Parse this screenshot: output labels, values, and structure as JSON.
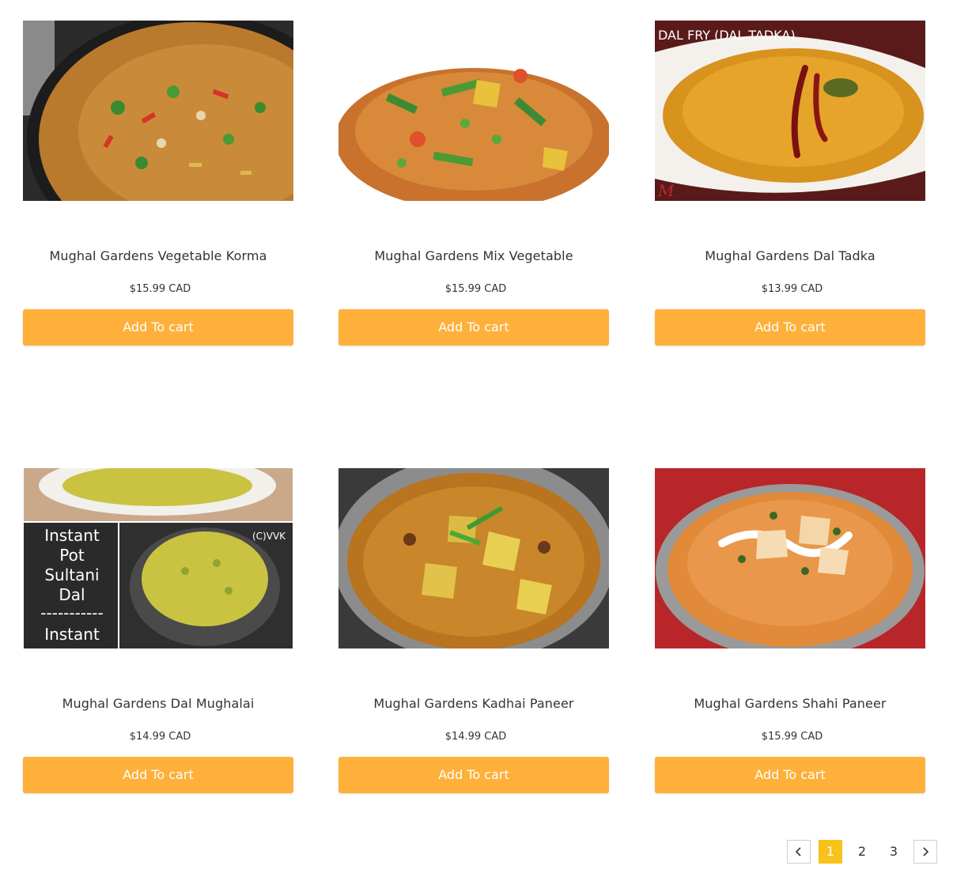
{
  "currency_note": "CAD",
  "products": [
    {
      "title": "Mughal Gardens Vegetable Korma",
      "price": "$15.99 CAD",
      "button": "Add To cart"
    },
    {
      "title": "Mughal Gardens Mix Vegetable",
      "price": "$15.99 CAD",
      "button": "Add To cart"
    },
    {
      "title": "Mughal Gardens Dal Tadka",
      "price": "$13.99 CAD",
      "button": "Add To cart"
    },
    {
      "title": "Mughal Gardens Dal Mughalai",
      "price": "$14.99 CAD",
      "button": "Add To cart"
    },
    {
      "title": "Mughal Gardens Kadhai Paneer",
      "price": "$14.99 CAD",
      "button": "Add To cart"
    },
    {
      "title": "Mughal Gardens Shahi Paneer",
      "price": "$15.99 CAD",
      "button": "Add To cart"
    }
  ],
  "image_text": {
    "dal_tadka_caption": "DAL FRY (DAL TADKA)",
    "sultani_line1": "Instant",
    "sultani_line2": "Pot",
    "sultani_line3": "Sultani",
    "sultani_line4": "Dal",
    "sultani_line5": "-----------",
    "sultani_line6": "Instant",
    "sultani_copyright": "(C)VVK"
  },
  "pagination": {
    "pages": [
      "1",
      "2",
      "3"
    ],
    "active_page": "1",
    "prev_icon": "chevron-left-icon",
    "next_icon": "chevron-right-icon"
  },
  "colors": {
    "button": "#ffb03b",
    "active_page": "#f7c21a"
  }
}
